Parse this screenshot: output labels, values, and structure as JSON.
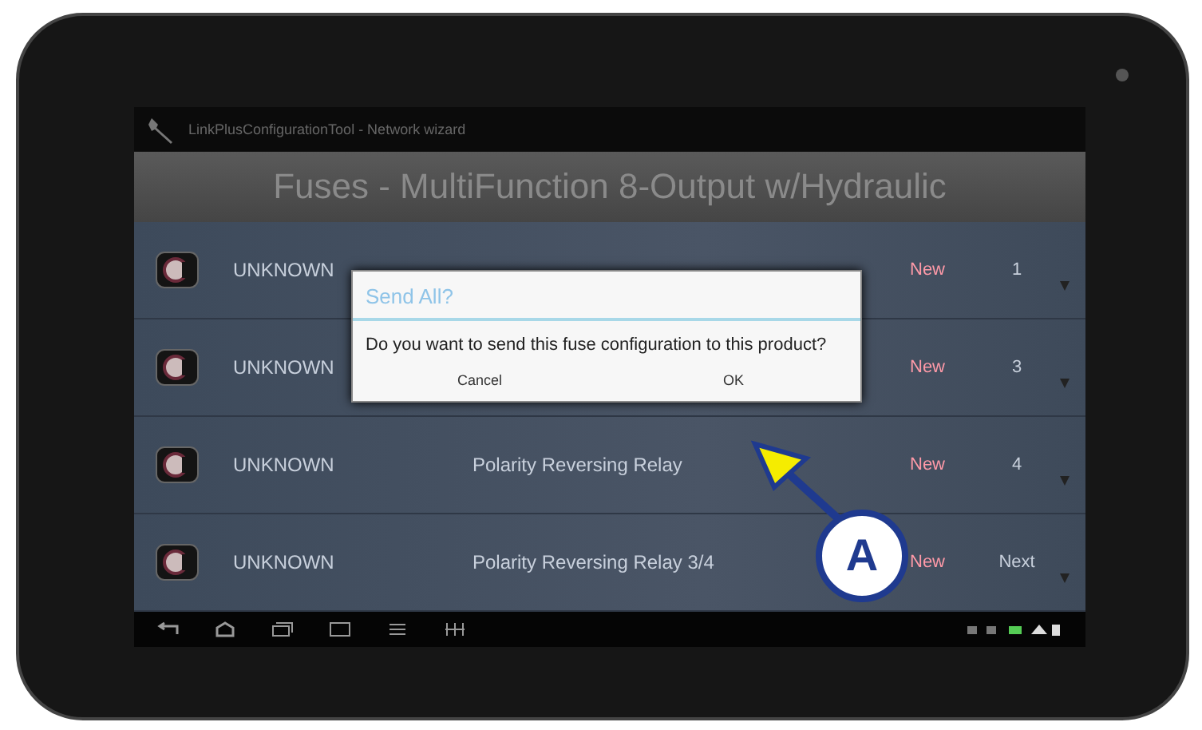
{
  "app_bar": {
    "title": "LinkPlusConfigurationTool - Network wizard"
  },
  "header": {
    "title": "Fuses - MultiFunction 8-Output w/Hydraulic"
  },
  "rows": [
    {
      "name": "UNKNOWN",
      "status": "New",
      "number": "1"
    },
    {
      "name": "UNKNOWN",
      "status": "New",
      "number": "3"
    },
    {
      "name": "UNKNOWN",
      "label": "Polarity Reversing Relay",
      "status": "New",
      "number": "4"
    },
    {
      "name": "UNKNOWN",
      "label": "Polarity Reversing Relay 3/4",
      "status": "New",
      "number": "Next"
    }
  ],
  "dialog": {
    "title": "Send All?",
    "message": "Do you want to send this fuse configuration to this product?",
    "buttons": [
      "Cancel",
      "OK"
    ]
  },
  "callout": {
    "label": "A"
  }
}
